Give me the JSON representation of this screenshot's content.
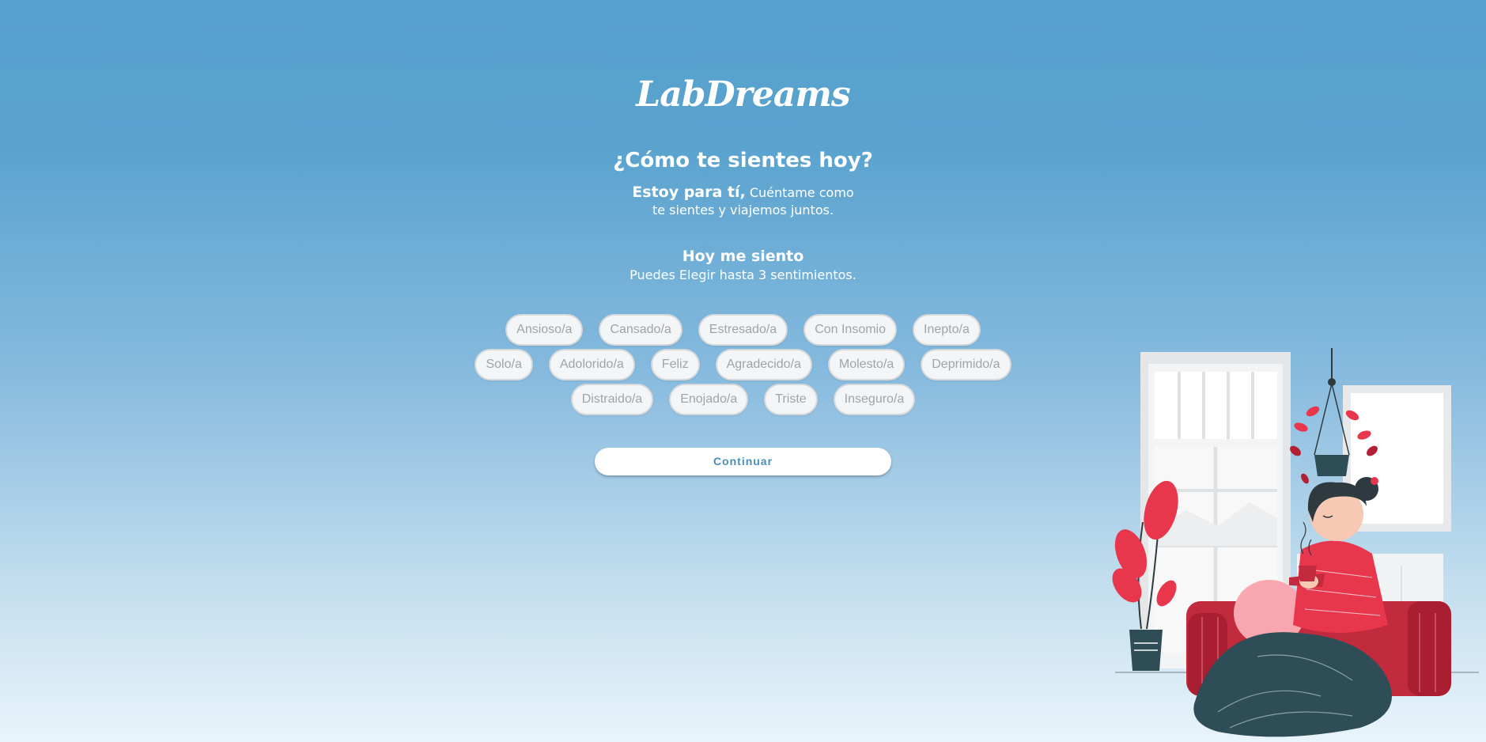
{
  "brand": {
    "logo_text": "LabDreams"
  },
  "header": {
    "title": "¿Cómo te sientes hoy?",
    "intro_strong": "Estoy para tí,",
    "intro_line1_rest": "Cuéntame como",
    "intro_line2": "te sientes y viajemos juntos."
  },
  "selection": {
    "heading": "Hoy me siento",
    "note": "Puedes Elegir hasta 3 sentimientos.",
    "row1": [
      "Ansioso/a",
      "Cansado/a",
      "Estresado/a",
      "Con Insomio",
      "Inepto/a"
    ],
    "row2": [
      "Solo/a",
      "Adolorido/a",
      "Feliz",
      "Agradecido/a",
      "Molesto/a",
      "Deprimido/a"
    ],
    "row3": [
      "Distraido/a",
      "Enojado/a",
      "Triste",
      "Inseguro/a"
    ]
  },
  "actions": {
    "continue_label": "Continuar"
  },
  "colors": {
    "background_top": "#56a0cd",
    "background_bottom": "#e9f4fb",
    "chip_text": "#9ea4a9",
    "button_text": "#4a8db9",
    "accent_red": "#e8364d"
  }
}
